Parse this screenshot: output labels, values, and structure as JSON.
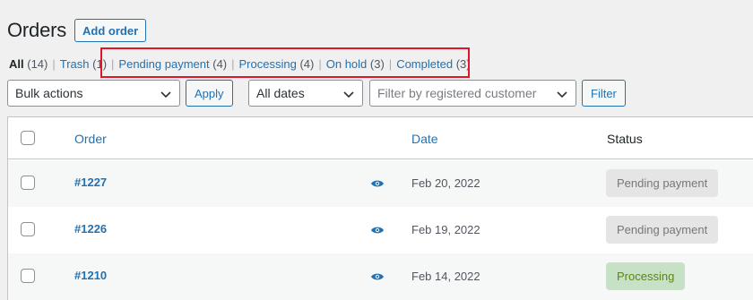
{
  "header": {
    "title": "Orders",
    "add_label": "Add order"
  },
  "views": [
    {
      "label": "All",
      "count": "(14)",
      "current": true
    },
    {
      "label": "Trash",
      "count": "(1)"
    },
    {
      "label": "Pending payment",
      "count": "(4)"
    },
    {
      "label": "Processing",
      "count": "(4)"
    },
    {
      "label": "On hold",
      "count": "(3)"
    },
    {
      "label": "Completed",
      "count": "(3)"
    }
  ],
  "separator": "|",
  "filters": {
    "bulk_actions": "Bulk actions",
    "apply_label": "Apply",
    "dates": "All dates",
    "customer_placeholder": "Filter by registered customer",
    "filter_label": "Filter"
  },
  "table": {
    "columns": {
      "order": "Order",
      "date": "Date",
      "status": "Status"
    },
    "rows": [
      {
        "order": "#1227",
        "date": "Feb 20, 2022",
        "status": "Pending payment",
        "status_type": "pending"
      },
      {
        "order": "#1226",
        "date": "Feb 19, 2022",
        "status": "Pending payment",
        "status_type": "pending"
      },
      {
        "order": "#1210",
        "date": "Feb 14, 2022",
        "status": "Processing",
        "status_type": "processing"
      }
    ]
  },
  "colors": {
    "link": "#2271b1",
    "highlight": "#e0142a",
    "pending_bg": "#e5e5e5",
    "processing_bg": "#c6e1c6"
  }
}
